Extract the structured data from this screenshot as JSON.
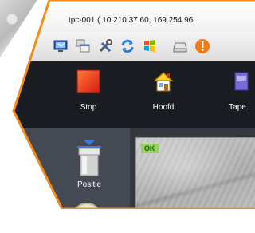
{
  "window": {
    "title": "tpc-001 ( 10.210.37.60, 169.254.96"
  },
  "toolbar": {
    "icons": [
      "monitor-icon",
      "windows-icon",
      "tools-icon",
      "refresh-icon",
      "windows-logo-icon",
      "drive-icon",
      "alert-icon"
    ]
  },
  "commands": {
    "stop_label": "Stop",
    "home_label": "Hoofd",
    "tape_label": "Tape"
  },
  "side": {
    "position_label": "Positie"
  },
  "camera": {
    "status": "OK"
  },
  "colors": {
    "hex_border": "#f28c1a",
    "command_bar": "#1a1d22",
    "stop_red": "#e8321a",
    "ok_green": "#93d35c"
  }
}
